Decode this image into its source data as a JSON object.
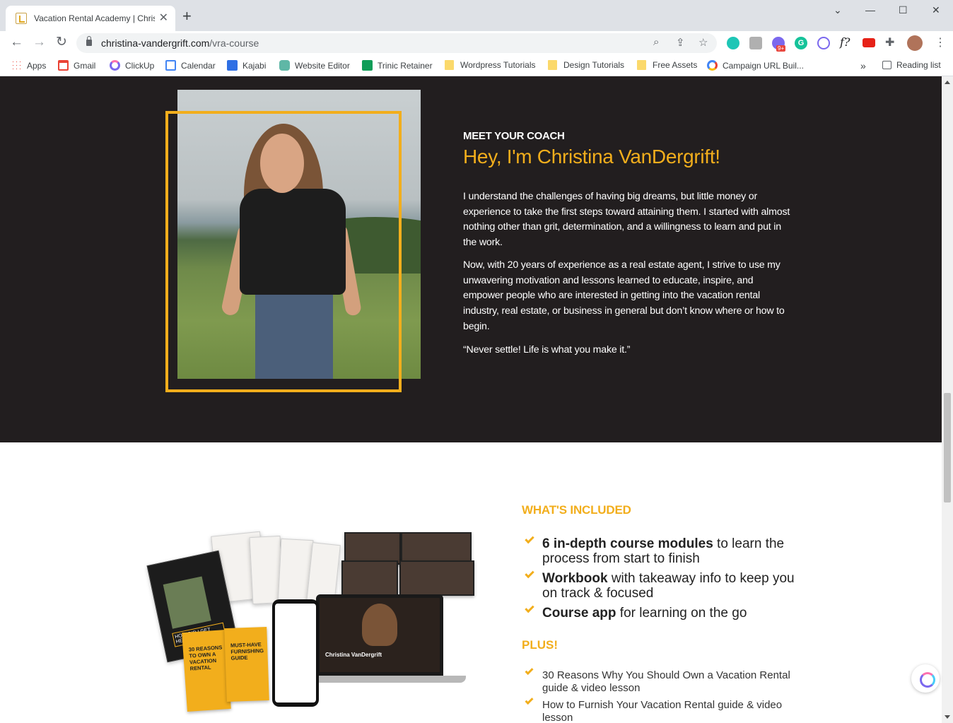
{
  "browser": {
    "tab_title": "Vacation Rental Academy | Christ",
    "url_host": "christina-vandergrift.com",
    "url_path": "/vra-course",
    "window_controls": [
      "⌄",
      "—",
      "☐",
      "✕"
    ],
    "extension_badge": "9+",
    "extension_f_label": "f?",
    "bookmarks": [
      {
        "label": "Apps",
        "icon": "apps-grid-icon"
      },
      {
        "label": "Gmail",
        "icon": "gmail-icon"
      },
      {
        "label": "ClickUp",
        "icon": "clickup-icon"
      },
      {
        "label": "Calendar",
        "icon": "calendar-icon"
      },
      {
        "label": "Kajabi",
        "icon": "kajabi-icon"
      },
      {
        "label": "Website Editor",
        "icon": "website-editor-icon"
      },
      {
        "label": "Trinic Retainer",
        "icon": "sheets-icon"
      },
      {
        "label": "Wordpress Tutorials",
        "icon": "folder-icon"
      },
      {
        "label": "Design Tutorials",
        "icon": "folder-icon"
      },
      {
        "label": "Free Assets",
        "icon": "folder-icon"
      },
      {
        "label": "Campaign URL Buil...",
        "icon": "google-icon"
      }
    ],
    "bookmarks_overflow": "»",
    "reading_list": "Reading list"
  },
  "coach": {
    "eyebrow": "MEET YOUR COACH",
    "headline": "Hey, I'm Christina VanDergrift!",
    "paragraph_1": "I understand the challenges of having big dreams, but little money or experience to take the first steps toward attaining them. I started with almost nothing other than grit, determination, and a willingness to learn and put in the work.",
    "paragraph_2": "Now, with 20 years of experience as a real estate agent, I strive to use my unwavering motivation and lessons learned to educate, inspire, and empower people who are interested in getting into the vacation rental industry, real estate, or business in general but don’t know where or how to begin.",
    "quote": "“Never settle! Life is what you make it.”"
  },
  "included": {
    "title": "WHAT'S INCLUDED",
    "items": [
      {
        "bold": "6 in-depth course modules",
        "rest": " to learn the process from start to finish"
      },
      {
        "bold": "Workbook",
        "rest": " with takeaway info to keep you on track & focused"
      },
      {
        "bold": "Course app",
        "rest": " for learning on the go"
      }
    ],
    "plus_title": "PLUS!",
    "plus_items": [
      "30 Reasons Why You Should Own a Vacation Rental guide & video lesson",
      "How to Furnish Your Vacation Rental guide & video lesson"
    ],
    "mockup": {
      "guide_1": "30 Reasons to own a vacation rental",
      "guide_2": "Must-have furnishing guide",
      "workbook_text": "How did I get here!?",
      "laptop_caption": "Christina VanDergrift"
    }
  },
  "colors": {
    "accent": "#f2ae1c",
    "dark_bg": "#221e1f"
  }
}
